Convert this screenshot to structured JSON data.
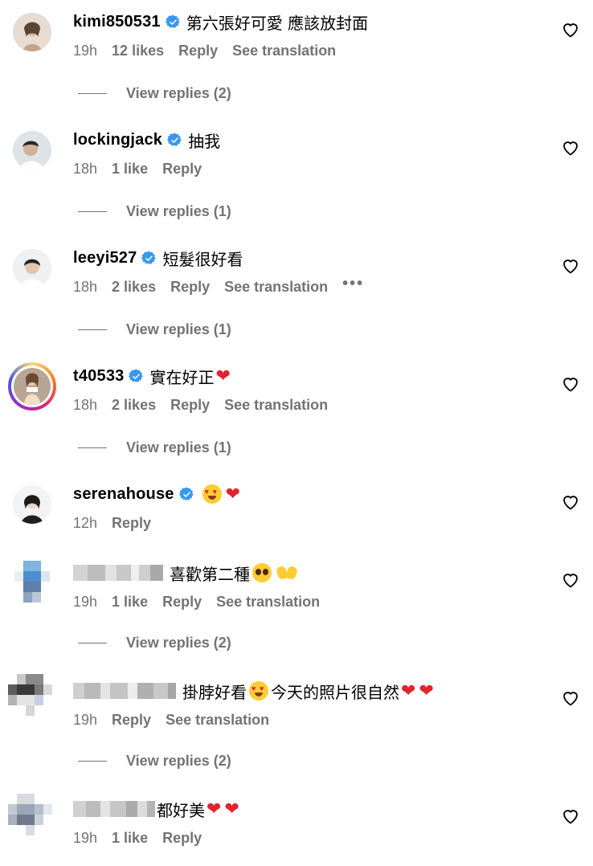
{
  "comments": [
    {
      "username": "kimi850531",
      "text": "第六張好可愛 應該放封面",
      "time": "19h",
      "likes": "12 likes",
      "reply": "Reply",
      "translation": "See translation",
      "view_replies": "View replies (2)"
    },
    {
      "username": "lockingjack",
      "text": "抽我",
      "time": "18h",
      "likes": "1 like",
      "reply": "Reply",
      "view_replies": "View replies (1)"
    },
    {
      "username": "leeyi527",
      "text": "短髮很好看",
      "time": "18h",
      "likes": "2 likes",
      "reply": "Reply",
      "translation": "See translation",
      "more": "•••",
      "view_replies": "View replies (1)"
    },
    {
      "username": "t40533",
      "text": "實在好正",
      "emoji": "❤",
      "time": "18h",
      "likes": "2 likes",
      "reply": "Reply",
      "translation": "See translation",
      "view_replies": "View replies (1)"
    },
    {
      "username": "serenahouse",
      "emoji": "❤",
      "time": "12h",
      "reply": "Reply"
    },
    {
      "text": "喜歡第二種",
      "time": "19h",
      "likes": "1 like",
      "reply": "Reply",
      "translation": "See translation",
      "view_replies": "View replies (2)"
    },
    {
      "text_a": "掛脖好看",
      "text_b": "今天的照片很自然",
      "emoji": "❤",
      "emoji2": "❤",
      "time": "19h",
      "reply": "Reply",
      "translation": "See translation",
      "view_replies": "View replies (2)"
    },
    {
      "text": "都好美",
      "emoji": "❤",
      "emoji2": "❤",
      "time": "19h",
      "likes": "1 like",
      "reply": "Reply"
    }
  ],
  "colors": {
    "verified_badge": "#3897f0",
    "secondary_text": "#737373",
    "heart_emoji": "#e0242e",
    "story_ring": "#d62976"
  },
  "icons": {
    "like": "heart-outline-icon",
    "verified": "verified-badge-icon"
  }
}
